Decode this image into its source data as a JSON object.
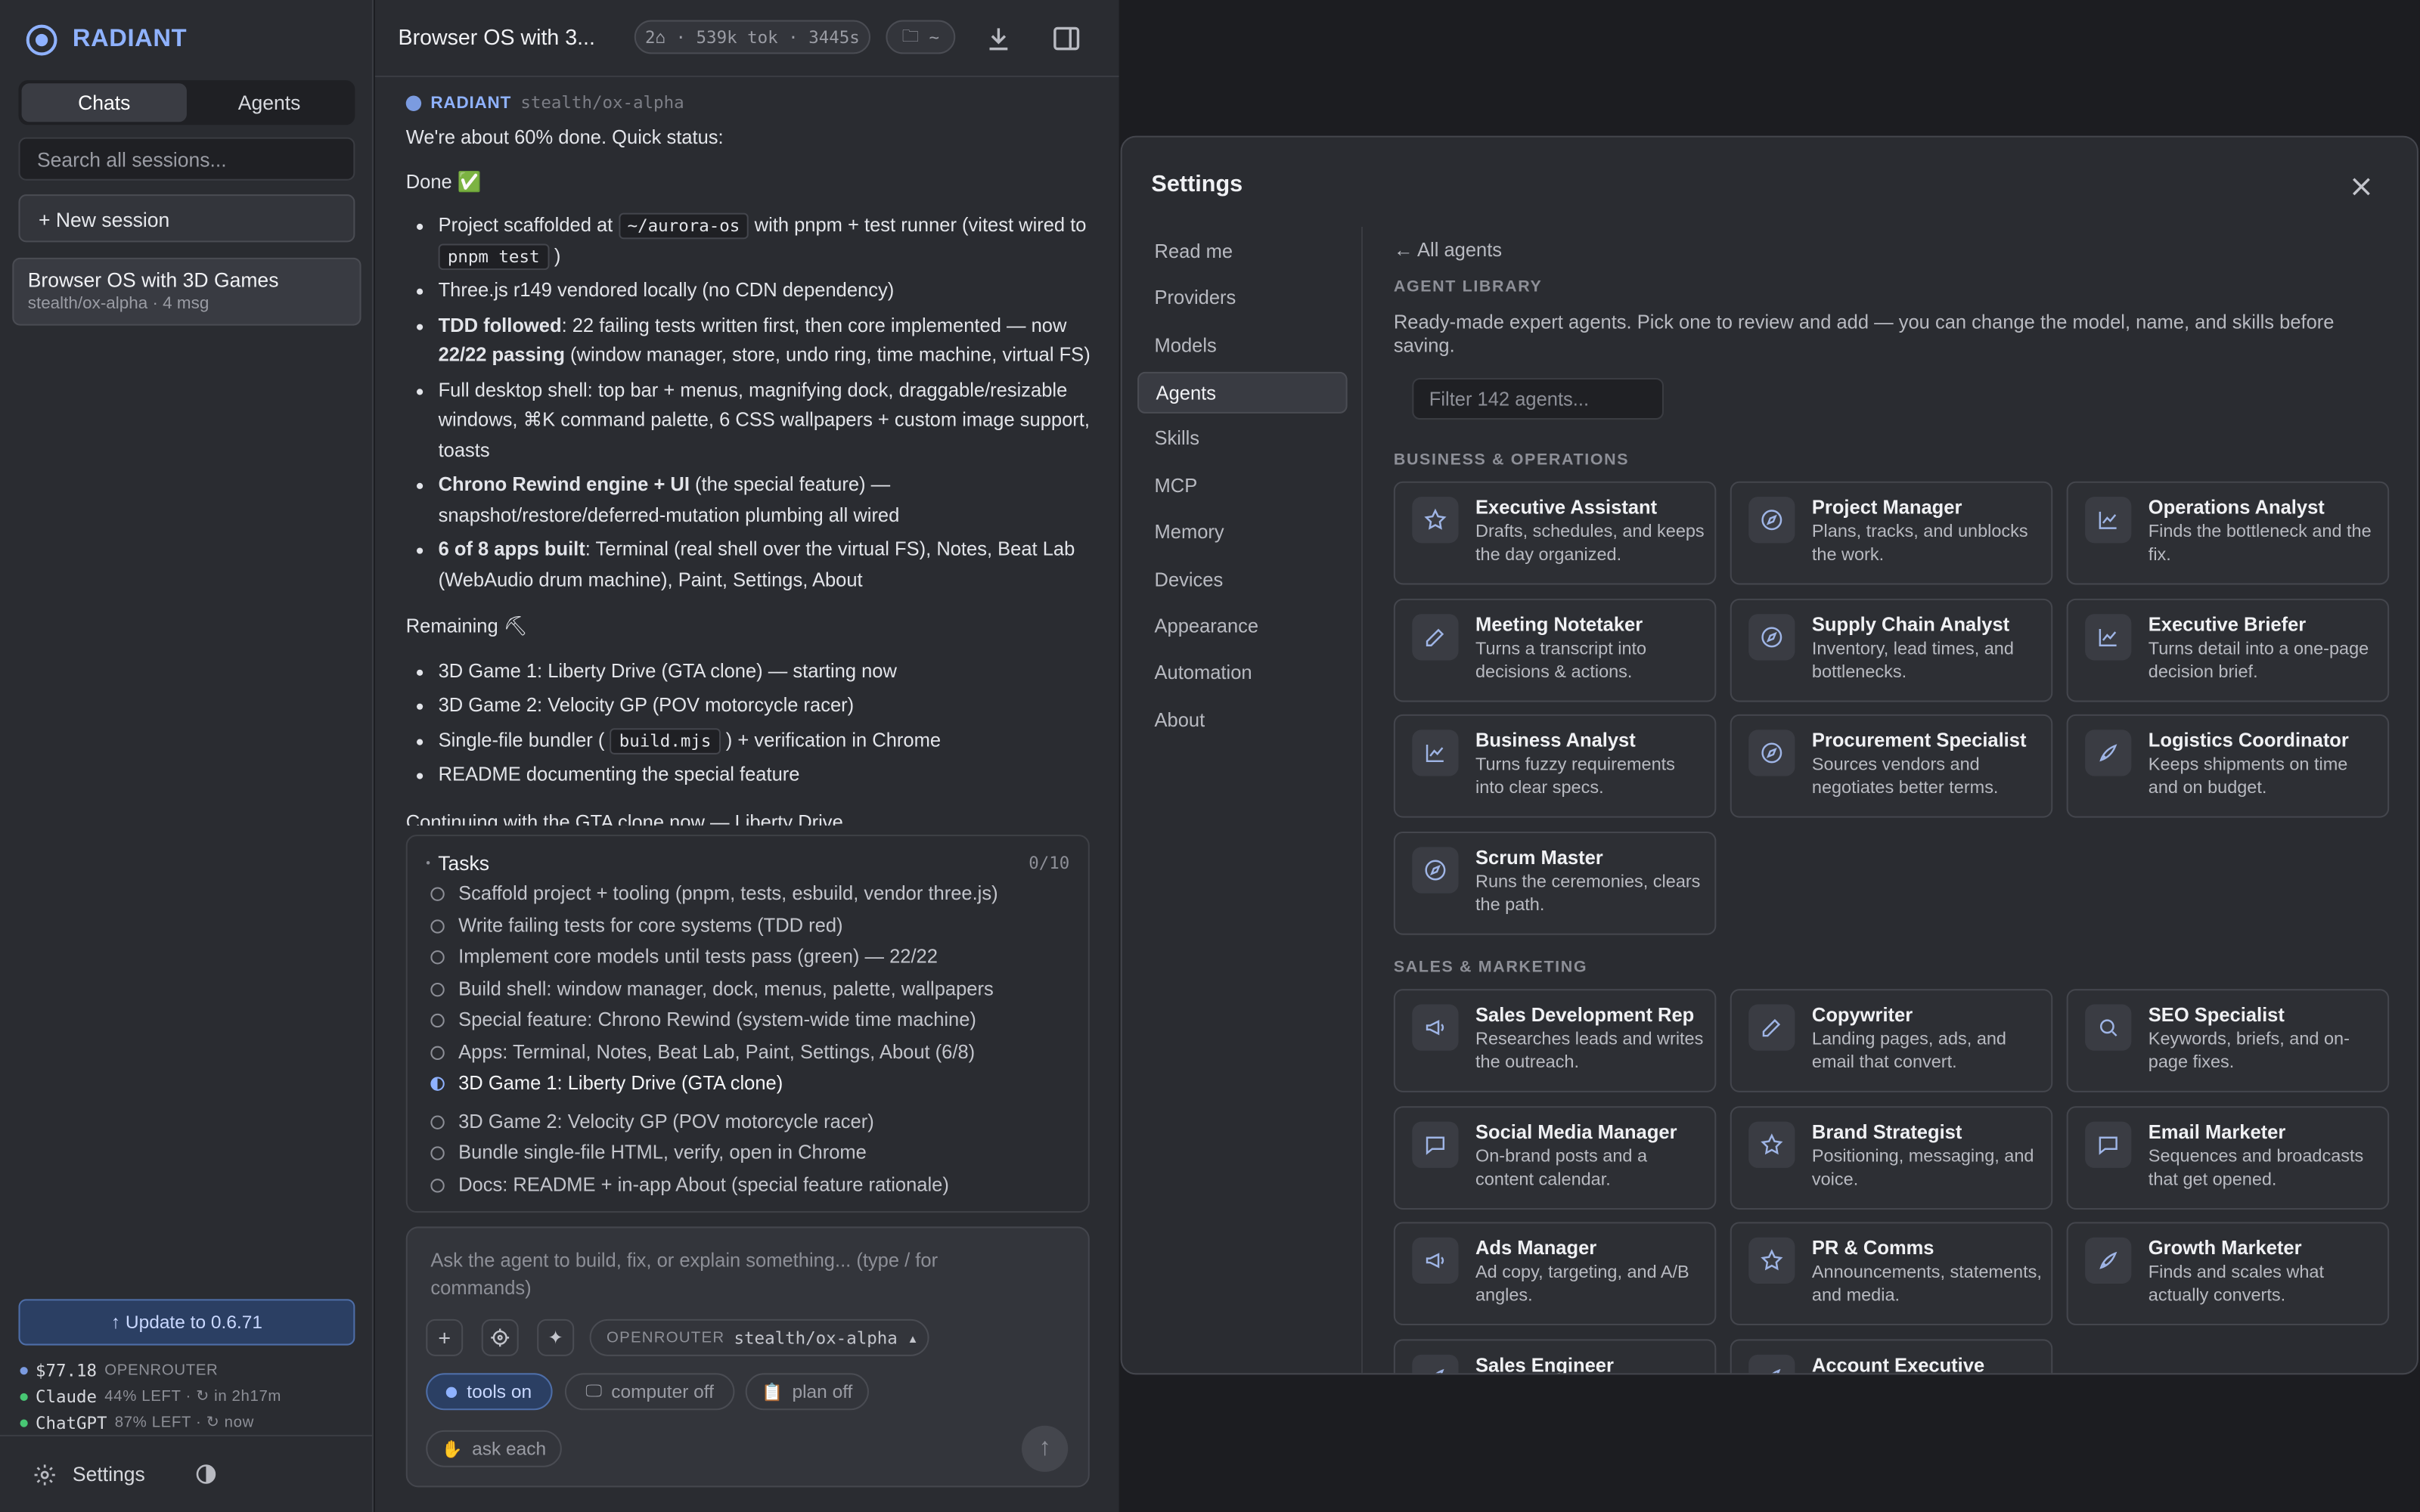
{
  "sidebar": {
    "brand": "RADIANT",
    "tabs": [
      "Chats",
      "Agents"
    ],
    "search_placeholder": "Search all sessions...",
    "new_session": "+ New session",
    "session": {
      "title": "Browser OS with 3D Games",
      "meta": "stealth/ox-alpha · 4 msg"
    },
    "update_label": "↑ Update to 0.6.71",
    "quotas": [
      {
        "label": "$77.18",
        "sub": "OPENROUTER",
        "color": "#7b9be0"
      },
      {
        "label": "Claude",
        "sub": "44% LEFT · ↻ in 2h17m",
        "color": "#48c774"
      },
      {
        "label": "ChatGPT",
        "sub": "87% LEFT · ↻ now",
        "color": "#48c774"
      }
    ],
    "settings_label": "Settings"
  },
  "chat": {
    "title": "Browser OS with 3...",
    "stats": "2⌂ · 539k tok · 3445s",
    "folder": "~",
    "sender": "RADIANT",
    "model": "stealth/ox-alpha",
    "intro": "We're about 60% done. Quick status:",
    "done_heading": "Done ✅",
    "done": {
      "d1a": "Project scaffolded at",
      "d1code": "~/aurora-os",
      "d1b": "with pnpm + test runner (vitest wired to",
      "d1code2": "pnpm test",
      "d1c": ")",
      "d2": "Three.js r149 vendored locally (no CDN dependency)",
      "d3b": "TDD followed",
      "d3": ": 22 failing tests written first, then core implemented — now",
      "d3b2": "22/22 passing",
      "d3c": "(window manager, store, undo ring, time machine, virtual FS)",
      "d4": "Full desktop shell: top bar + menus, magnifying dock, draggable/resizable windows, ⌘K command palette, 6 CSS wallpapers + custom image support, toasts",
      "d5b": "Chrono Rewind engine + UI",
      "d5": "(the special feature) — snapshot/restore/deferred-mutation plumbing all wired",
      "d6b": "6 of 8 apps built",
      "d6": ": Terminal (real shell over the virtual FS), Notes, Beat Lab (WebAudio drum machine), Paint, Settings, About"
    },
    "remaining_heading": "Remaining ⛏",
    "remaining": {
      "r1": "3D Game 1: Liberty Drive (GTA clone) — starting now",
      "r2": "3D Game 2: Velocity GP (POV motorcycle racer)",
      "r3a": "Single-file bundler (",
      "r3code": "build.mjs",
      "r3b": ") + verification in Chrome",
      "r4": "README documenting the special feature"
    },
    "trailing": "Continuing with the GTA clone now — Liberty Drive..."
  },
  "tasks": {
    "title": "Tasks",
    "count": "0/10",
    "items": [
      "Scaffold project + tooling (pnpm, tests, esbuild, vendor three.js)",
      "Write failing tests for core systems (TDD red)",
      "Implement core models until tests pass (green) — 22/22",
      "Build shell: window manager, dock, menus, palette, wallpapers",
      "Special feature: Chrono Rewind (system-wide time machine)",
      "Apps: Terminal, Notes, Beat Lab, Paint, Settings, About (6/8)",
      "3D Game 1: Liberty Drive (GTA clone)",
      "3D Game 2: Velocity GP (POV motorcycle racer)",
      "Bundle single-file HTML, verify, open in Chrome",
      "Docs: README + in-app About (special feature rationale)"
    ]
  },
  "composer": {
    "placeholder": "Ask the agent to build, fix, or explain something...  (type / for commands)",
    "provider": "OPENROUTER",
    "model": "stealth/ox-alpha ▴",
    "tools": "tools on",
    "computer": "computer off",
    "plan": "plan off",
    "ask": "ask each"
  },
  "settings": {
    "title": "Settings",
    "nav": [
      "Read me",
      "Providers",
      "Models",
      "Agents",
      "Skills",
      "MCP",
      "Memory",
      "Devices",
      "Appearance",
      "Automation",
      "About"
    ],
    "back": "← All agents",
    "library_heading": "AGENT LIBRARY",
    "library_desc": "Ready-made expert agents. Pick one to review and add — you can change the model, name, and skills before saving.",
    "filter_placeholder": "Filter 142 agents...",
    "sections": [
      {
        "title": "BUSINESS & OPERATIONS",
        "cards": [
          {
            "name": "Executive Assistant",
            "desc": "Drafts, schedules, and keeps the day organized.",
            "icon": "star"
          },
          {
            "name": "Project Manager",
            "desc": "Plans, tracks, and unblocks the work.",
            "icon": "compass"
          },
          {
            "name": "Operations Analyst",
            "desc": "Finds the bottleneck and the fix.",
            "icon": "chart"
          },
          {
            "name": "Meeting Notetaker",
            "desc": "Turns a transcript into decisions & actions.",
            "icon": "pen"
          },
          {
            "name": "Supply Chain Analyst",
            "desc": "Inventory, lead times, and bottlenecks.",
            "icon": "compass"
          },
          {
            "name": "Executive Briefer",
            "desc": "Turns detail into a one-page decision brief.",
            "icon": "chart"
          },
          {
            "name": "Business Analyst",
            "desc": "Turns fuzzy requirements into clear specs.",
            "icon": "chart"
          },
          {
            "name": "Procurement Specialist",
            "desc": "Sources vendors and negotiates better terms.",
            "icon": "compass"
          },
          {
            "name": "Logistics Coordinator",
            "desc": "Keeps shipments on time and on budget.",
            "icon": "rocket"
          },
          {
            "name": "Scrum Master",
            "desc": "Runs the ceremonies, clears the path.",
            "icon": "compass"
          }
        ]
      },
      {
        "title": "SALES & MARKETING",
        "cards": [
          {
            "name": "Sales Development Rep",
            "desc": "Researches leads and writes the outreach.",
            "icon": "megaphone"
          },
          {
            "name": "Copywriter",
            "desc": "Landing pages, ads, and email that convert.",
            "icon": "pen"
          },
          {
            "name": "SEO Specialist",
            "desc": "Keywords, briefs, and on-page fixes.",
            "icon": "search"
          },
          {
            "name": "Social Media Manager",
            "desc": "On-brand posts and a content calendar.",
            "icon": "chat"
          },
          {
            "name": "Brand Strategist",
            "desc": "Positioning, messaging, and voice.",
            "icon": "star"
          },
          {
            "name": "Email Marketer",
            "desc": "Sequences and broadcasts that get opened.",
            "icon": "chat"
          },
          {
            "name": "Ads Manager",
            "desc": "Ad copy, targeting, and A/B angles.",
            "icon": "megaphone"
          },
          {
            "name": "PR & Comms",
            "desc": "Announcements, statements, and media.",
            "icon": "star"
          },
          {
            "name": "Growth Marketer",
            "desc": "Finds and scales what actually converts.",
            "icon": "rocket"
          },
          {
            "name": "Sales Engineer",
            "desc": "",
            "icon": "rocket"
          },
          {
            "name": "Account Executive",
            "desc": "",
            "icon": "rocket"
          }
        ]
      }
    ]
  }
}
